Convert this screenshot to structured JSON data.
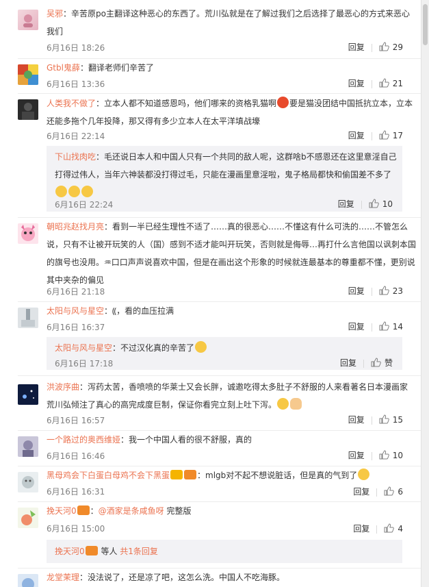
{
  "comments": [
    {
      "name": "吴邪",
      "text": "：辛苦原po主翻译这种恶心的东西了。荒川弘就是在了解过我们之后选择了最恶心的方式来恶心我们",
      "text2": "",
      "time": "6月16日 18:26",
      "reply": "回复",
      "likes": "29"
    },
    {
      "name": "Gtbl鬼薛",
      "text": "：翻译老师们辛苦了",
      "time": "6月16日 13:36",
      "reply": "回复",
      "likes": "21"
    },
    {
      "name": "人类我不做了",
      "text": "：立本人都不知道感恩吗，他们哪来的资格乳猫啊",
      "text2": "要是猫没团结中国抵抗立本，立本还能多拖个几年投降，那又得有多少立本人在太平洋填战壕",
      "time": "6月16日 22:14",
      "reply": "回复",
      "likes": "17",
      "sub": {
        "name": "下山找肉吃",
        "text": "：毛还说日本人和中国人只有一个共同的敌人呢，这群啥b不感恩还在这里意淫自己打得过伟人，当年六神装都没打得过毛，只能在漫画里意淫啦，鬼子格局都快和偷国差不多了",
        "time": "6月16日 22:24",
        "reply": "回复",
        "likes": "10"
      }
    },
    {
      "name": "朝昭兆赵找月亮",
      "text": "：看到一半已经生理性不适了……真的很恶心……不懂这有什么可洗的……不管怎么说，只有不让被开玩笑的人（国）感到不适才能叫开玩笑，否则就是侮辱…再打什么言他国以讽刺本国的旗号也没用。♒口口声声说喜欢中国，但是在画出这个形象的时候就连最基本的尊重都不懂，更别说其中夹杂的偏见",
      "time": "6月16日 21:18",
      "reply": "回复",
      "likes": "23"
    },
    {
      "name": "太阳与风与星空",
      "text": "：⸨，看的血压拉满",
      "time": "6月16日 16:37",
      "reply": "回复",
      "likes": "14",
      "sub": {
        "name": "太阳与风与星空",
        "text": "：不过汉化真的辛苦了",
        "time": "6月16日 17:18",
        "reply": "回复",
        "likes": "赞"
      }
    },
    {
      "name": "洪波序曲",
      "text": "：泻药太苦，香喷喷的华莱士又会长胖，诚邀吃得太多肚子不舒服的人来看著名日本漫画家荒川弘倾注了真心的高完成度巨制，保证你看完立刻上吐下泻。",
      "time": "6月16日 16:57",
      "reply": "回复",
      "likes": "15"
    },
    {
      "name": "一个路过的奥西维娅",
      "text": "：我一个中国人看的很不舒服，真的",
      "time": "6月16日 16:46",
      "reply": "回复",
      "likes": "10"
    },
    {
      "name": "黑母鸡会下白蛋白母鸡不会下黑蛋",
      "text": "：mlgb对不起不想说脏话，但是真的气到了",
      "time": "6月16日 16:31",
      "reply": "回复",
      "likes": "6"
    },
    {
      "name": "挽天河0",
      "text": "：@酒家是条咸鱼呀 完整版",
      "mention": "@酒家是条咸鱼呀",
      "rest": " 完整版",
      "time": "6月16日 15:00",
      "reply": "回复",
      "likes": "4",
      "sub": {
        "name": "挽天河0",
        "text": " 等人 ",
        "link": "共1条回复"
      }
    },
    {
      "name": "龙堂茉理",
      "text": "：没法说了，还是凉了吧，这怎么洗。中国人不吃海豚。"
    }
  ]
}
